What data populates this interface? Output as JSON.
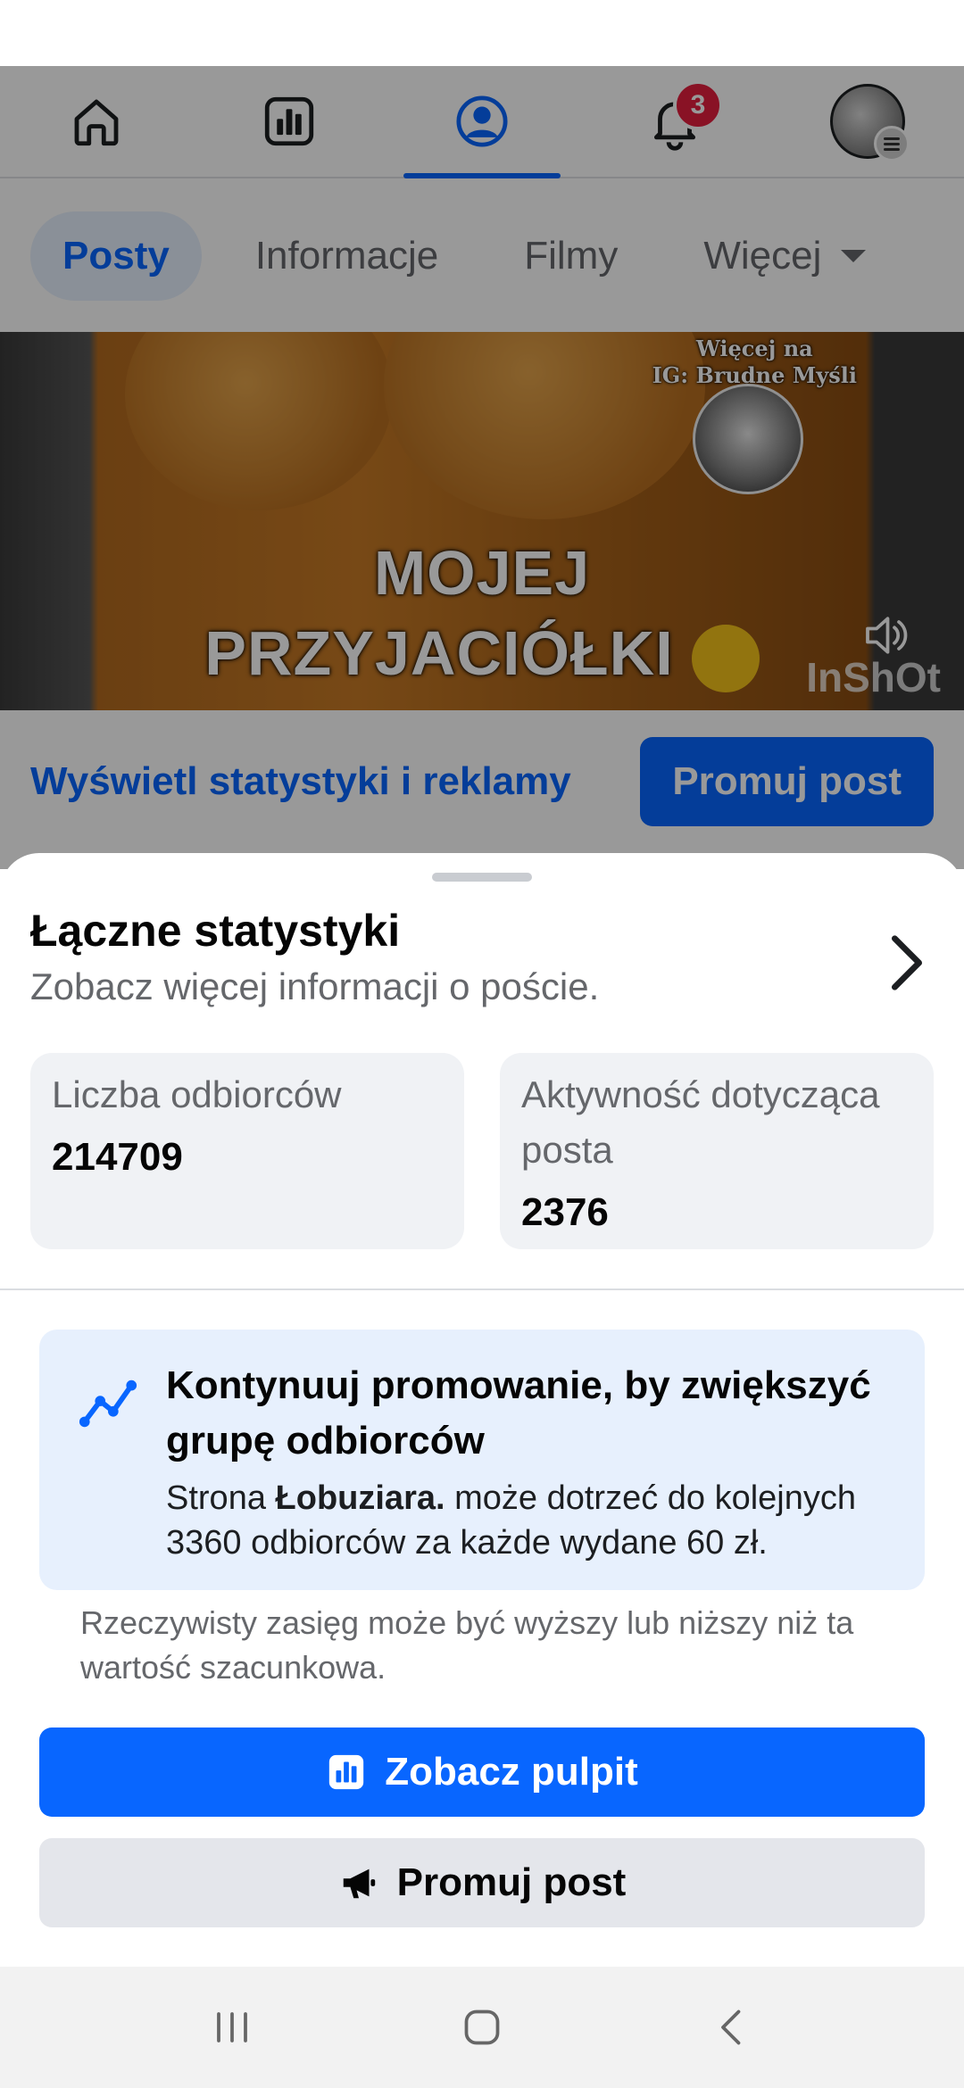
{
  "top_nav": {
    "items": [
      {
        "name": "home",
        "icon": "home-icon"
      },
      {
        "name": "insights",
        "icon": "bar-chart-icon"
      },
      {
        "name": "profile",
        "icon": "profile-icon",
        "active": true
      },
      {
        "name": "notifications",
        "icon": "bell-icon",
        "badge": "3"
      },
      {
        "name": "menu",
        "icon": "avatar-menu-icon"
      }
    ]
  },
  "tabs": [
    {
      "label": "Posty",
      "active": true
    },
    {
      "label": "Informacje"
    },
    {
      "label": "Filmy"
    },
    {
      "label": "Więcej"
    }
  ],
  "video": {
    "note_line1": "Więcej na",
    "note_line2": "IG: Brudne Myśli",
    "text_line1": "MOJEJ",
    "text_line2": "PRZYJACIÓŁKI",
    "watermark": "InShOt",
    "emoji": "tears-of-joy-emoji",
    "sound_icon": "speaker-icon"
  },
  "post_actions": {
    "stats_link": "Wyświetl statystyki i reklamy",
    "promote_label": "Promuj post"
  },
  "sheet": {
    "title": "Łączne statystyki",
    "subtitle": "Zobacz więcej informacji o poście.",
    "metrics": [
      {
        "label": "Liczba odbiorców",
        "value": "214709"
      },
      {
        "label": "Aktywność dotycząca posta",
        "value": "2376"
      }
    ],
    "promo": {
      "heading": "Kontynuuj promowanie, by zwiększyć grupę odbiorców",
      "body_prefix": "Strona ",
      "page_name": "Łobuziara.",
      "body_suffix": " może dotrzeć do kolejnych 3360 odbiorców za każde wydane 60 zł."
    },
    "disclaimer": "Rzeczywisty zasięg może być wyższy lub niższy niż ta wartość szacunkowa.",
    "primary_button": "Zobacz pulpit",
    "secondary_button": "Promuj post"
  },
  "colors": {
    "accent": "#0866ff",
    "badge": "#e41e3f",
    "promo_bg": "#e7f0fd",
    "metric_bg": "#f0f2f5"
  }
}
